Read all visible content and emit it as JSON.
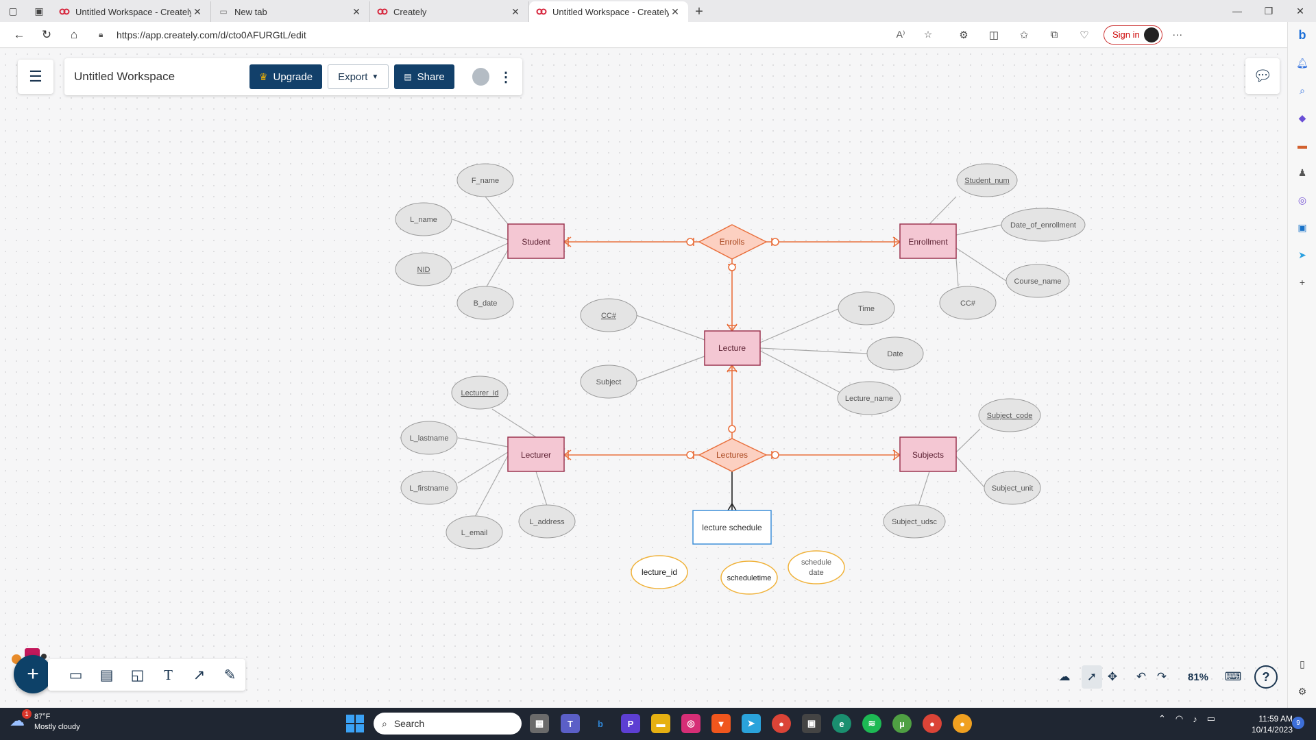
{
  "browser": {
    "tabs": [
      {
        "title": "Untitled Workspace - Creately",
        "icon": "creately-icon",
        "active": false
      },
      {
        "title": "New tab",
        "icon": "newtab-icon",
        "active": false
      },
      {
        "title": "Creately",
        "icon": "creately-icon",
        "active": false
      },
      {
        "title": "Untitled Workspace - Creately",
        "icon": "creately-icon",
        "active": true
      }
    ],
    "url": "https://app.creately.com/d/cto0AFURGtL/edit",
    "signin_label": "Sign in"
  },
  "app": {
    "workspace_title": "Untitled Workspace",
    "upgrade_label": "Upgrade",
    "export_label": "Export",
    "share_label": "Share",
    "zoom": "81%",
    "help": "?"
  },
  "diagram": {
    "entities": {
      "student": "Student",
      "enrollment": "Enrollment",
      "lecture": "Lecture",
      "lecturer": "Lecturer",
      "subjects": "Subjects"
    },
    "relationships": {
      "enrolls": "Enrolls",
      "lectures": "Lectures"
    },
    "attributes": {
      "f_name": "F_name",
      "l_name": "L_name",
      "nid": "NID",
      "b_date": "B_date",
      "student_num": "Student_num",
      "date_of_enrollment": "Date_of_enrollment",
      "course_name": "Course_name",
      "enroll_cc": "CC#",
      "lecture_cc": "CC#",
      "lecture_subject": "Subject",
      "time": "Time",
      "date": "Date",
      "lecture_name": "Lecture_name",
      "lecturer_id": "Lecturer_id",
      "l_lastname": "L_lastname",
      "l_firstname": "L_firstname",
      "l_email": "L_email",
      "l_address": "L_address",
      "subject_code": "Subject_code",
      "subject_unit": "Subject_unit",
      "subject_udsc": "Subject_udsc",
      "lecture_id": "lecture_id",
      "scheduletime": "scheduletime",
      "schedule_date_1": "schedule",
      "schedule_date_2": "date"
    },
    "weak_entity": "lecture schedule",
    "colors": {
      "entity_fill": "#f4c7d3",
      "entity_stroke": "#9b3550",
      "relation_fill": "#fcd0c1",
      "relation_stroke": "#e9703d",
      "connector": "#e9703d",
      "attribute_fill": "#e4e4e4",
      "attribute_stroke": "#9a9a9a",
      "schedule_stroke": "#f0b23a",
      "weak_stroke": "#3b8ed8"
    }
  },
  "taskbar": {
    "weather_temp": "87°F",
    "weather_desc": "Mostly cloudy",
    "weather_badge": "1",
    "search_placeholder": "Search",
    "time": "11:59 AM",
    "date": "10/14/2023",
    "notification_count": "9"
  }
}
